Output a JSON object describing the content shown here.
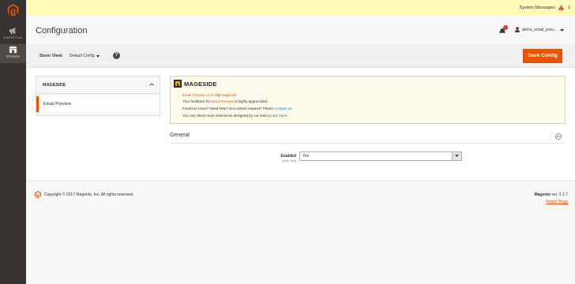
{
  "sidebar": {
    "items": [
      {
        "label": "MARKETING",
        "icon": "megaphone-icon"
      },
      {
        "label": "STORES",
        "icon": "store-icon"
      }
    ]
  },
  "system_messages": {
    "label": "System Messages:",
    "count": "1"
  },
  "header": {
    "title": "Configuration",
    "notifications_count": "1",
    "user_name": "demo_email_prev..."
  },
  "store_view": {
    "label": "Store View:",
    "selected": "Default Config",
    "help_symbol": "?",
    "save_label": "Save Config"
  },
  "tabs": {
    "group_title": "MAGESIDE",
    "items": [
      {
        "label": "Email Preview",
        "active": true
      }
    ]
  },
  "extension_info": {
    "brand": "MAGESIDE",
    "line1": {
      "product": "Email Preview v1.0.0",
      "by": " by ",
      "vendor": "Mageside"
    },
    "line2": {
      "pre": "Your feedback for ",
      "product": "Email Preview",
      "post": " is highly appreciated."
    },
    "line3": {
      "pre": "Found an issue? Need help? Got custom request? Please ",
      "link": "Contact us",
      "post": "."
    },
    "line4": {
      "pre": "You can check more extensions designed by our team in our ",
      "link": "Store",
      "post": "."
    }
  },
  "general": {
    "title": "General",
    "field_label": "Enabled",
    "field_scope": "[store view]",
    "field_value": "Yes"
  },
  "footer": {
    "copyright": "Copyright © 2017 Magento, Inc. All rights reserved.",
    "brand": "Magento",
    "version": " ver. 2.1.7",
    "report_bugs": "Report Bugs"
  },
  "colors": {
    "accent": "#eb5202",
    "sidebar": "#373330",
    "notice_bg": "#fffbbb",
    "info_bg": "#fffbeb",
    "link": "#1979c3"
  }
}
